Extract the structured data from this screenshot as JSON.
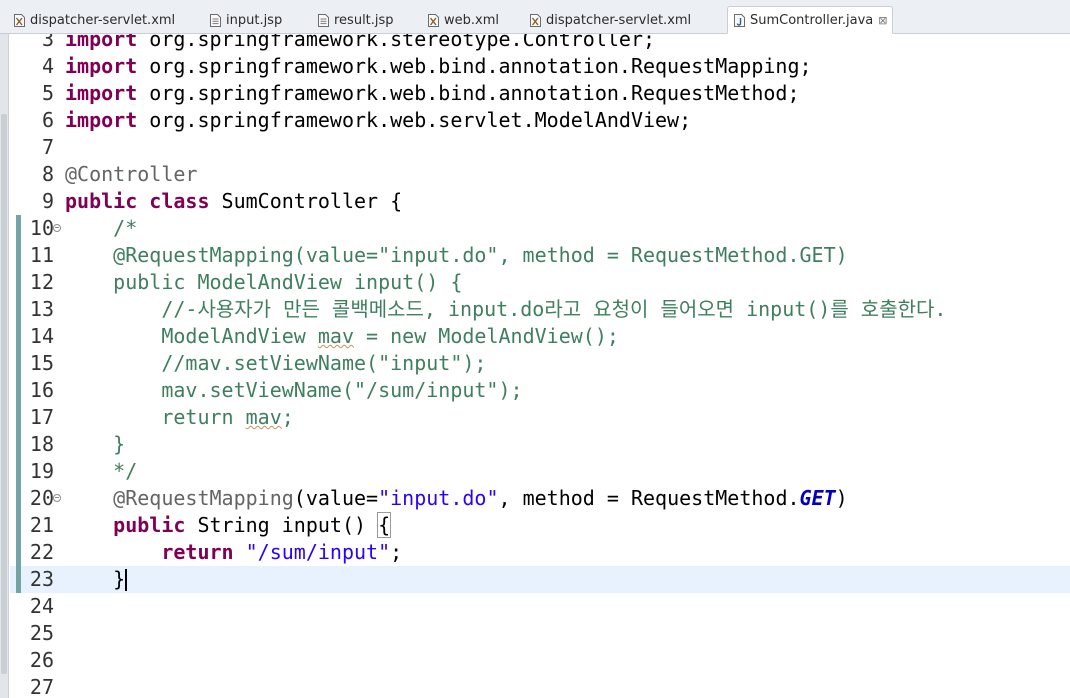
{
  "tabs": [
    {
      "label": "dispatcher-servlet.xml",
      "icon": "xml-file-icon",
      "active": false
    },
    {
      "label": "input.jsp",
      "icon": "jsp-file-icon",
      "active": false
    },
    {
      "label": "result.jsp",
      "icon": "jsp-file-icon",
      "active": false
    },
    {
      "label": "web.xml",
      "icon": "xml-file-icon",
      "active": false
    },
    {
      "label": "dispatcher-servlet.xml",
      "icon": "xml-file-icon",
      "active": false
    },
    {
      "label": "SumController.java",
      "icon": "java-file-icon",
      "active": true,
      "close": "⊠"
    }
  ],
  "editor": {
    "current_line": 23,
    "lines": [
      {
        "n": "3",
        "tokens": [
          {
            "t": "import ",
            "c": "kw"
          },
          {
            "t": "org.springframework.stereotype.Controller;",
            "c": "pl"
          }
        ]
      },
      {
        "n": "4",
        "tokens": [
          {
            "t": "import ",
            "c": "kw"
          },
          {
            "t": "org.springframework.web.bind.annotation.RequestMapping;",
            "c": "pl"
          }
        ]
      },
      {
        "n": "5",
        "tokens": [
          {
            "t": "import ",
            "c": "kw"
          },
          {
            "t": "org.springframework.web.bind.annotation.RequestMethod;",
            "c": "pl"
          }
        ]
      },
      {
        "n": "6",
        "tokens": [
          {
            "t": "import ",
            "c": "kw"
          },
          {
            "t": "org.springframework.web.servlet.ModelAndView;",
            "c": "pl"
          }
        ]
      },
      {
        "n": "7",
        "tokens": []
      },
      {
        "n": "8",
        "tokens": [
          {
            "t": "@Controller",
            "c": "ann"
          }
        ]
      },
      {
        "n": "9",
        "tokens": [
          {
            "t": "public ",
            "c": "kw"
          },
          {
            "t": "class ",
            "c": "kw"
          },
          {
            "t": "SumController {",
            "c": "pl"
          }
        ]
      },
      {
        "n": "10",
        "fold": true,
        "mark": true,
        "tokens": [
          {
            "t": "    /*",
            "c": "cm"
          }
        ]
      },
      {
        "n": "11",
        "mark": true,
        "tokens": [
          {
            "t": "    @RequestMapping(value=\"input.do\", method = RequestMethod.GET)",
            "c": "cm"
          }
        ]
      },
      {
        "n": "12",
        "mark": true,
        "tokens": [
          {
            "t": "    public ModelAndView input() {",
            "c": "cm"
          }
        ]
      },
      {
        "n": "13",
        "mark": true,
        "tokens": [
          {
            "t": "        //-사용자가 만든 콜백메소드, input.do라고 요청이 들어오면 input()를 호출한다.",
            "c": "cm"
          }
        ]
      },
      {
        "n": "14",
        "mark": true,
        "tokens": [
          {
            "t": "        ModelAndView ",
            "c": "cm"
          },
          {
            "t": "mav",
            "c": "cm warn"
          },
          {
            "t": " = new ModelAndView();",
            "c": "cm"
          }
        ]
      },
      {
        "n": "15",
        "mark": true,
        "tokens": [
          {
            "t": "        //mav.setViewName(\"input\");",
            "c": "cm"
          }
        ]
      },
      {
        "n": "16",
        "mark": true,
        "tokens": [
          {
            "t": "        mav.setViewName(\"/sum/input\");",
            "c": "cm"
          }
        ]
      },
      {
        "n": "17",
        "mark": true,
        "tokens": [
          {
            "t": "        return ",
            "c": "cm"
          },
          {
            "t": "mav",
            "c": "cm warn"
          },
          {
            "t": ";",
            "c": "cm"
          }
        ]
      },
      {
        "n": "18",
        "mark": true,
        "tokens": [
          {
            "t": "    }",
            "c": "cm"
          }
        ]
      },
      {
        "n": "19",
        "mark": true,
        "tokens": [
          {
            "t": "    */",
            "c": "cm"
          }
        ]
      },
      {
        "n": "20",
        "fold": true,
        "mark": true,
        "tokens": [
          {
            "t": "    @RequestMapping",
            "c": "ann"
          },
          {
            "t": "(value=",
            "c": "pl"
          },
          {
            "t": "\"input.do\"",
            "c": "str"
          },
          {
            "t": ", method = RequestMethod.",
            "c": "pl"
          },
          {
            "t": "GET",
            "c": "stat"
          },
          {
            "t": ")",
            "c": "pl"
          }
        ]
      },
      {
        "n": "21",
        "mark": true,
        "tokens": [
          {
            "t": "    public ",
            "c": "kw"
          },
          {
            "t": "String input() ",
            "c": "pl"
          },
          {
            "t": "{",
            "c": "pl brace-box"
          }
        ]
      },
      {
        "n": "22",
        "mark": true,
        "tokens": [
          {
            "t": "        return ",
            "c": "kw"
          },
          {
            "t": "\"/sum/input\"",
            "c": "str"
          },
          {
            "t": ";",
            "c": "pl"
          }
        ]
      },
      {
        "n": "23",
        "mark": true,
        "tokens": [
          {
            "t": "    }",
            "c": "pl"
          }
        ]
      },
      {
        "n": "24",
        "tokens": []
      },
      {
        "n": "25",
        "tokens": []
      },
      {
        "n": "26",
        "tokens": []
      },
      {
        "n": "27",
        "tokens": []
      }
    ]
  }
}
